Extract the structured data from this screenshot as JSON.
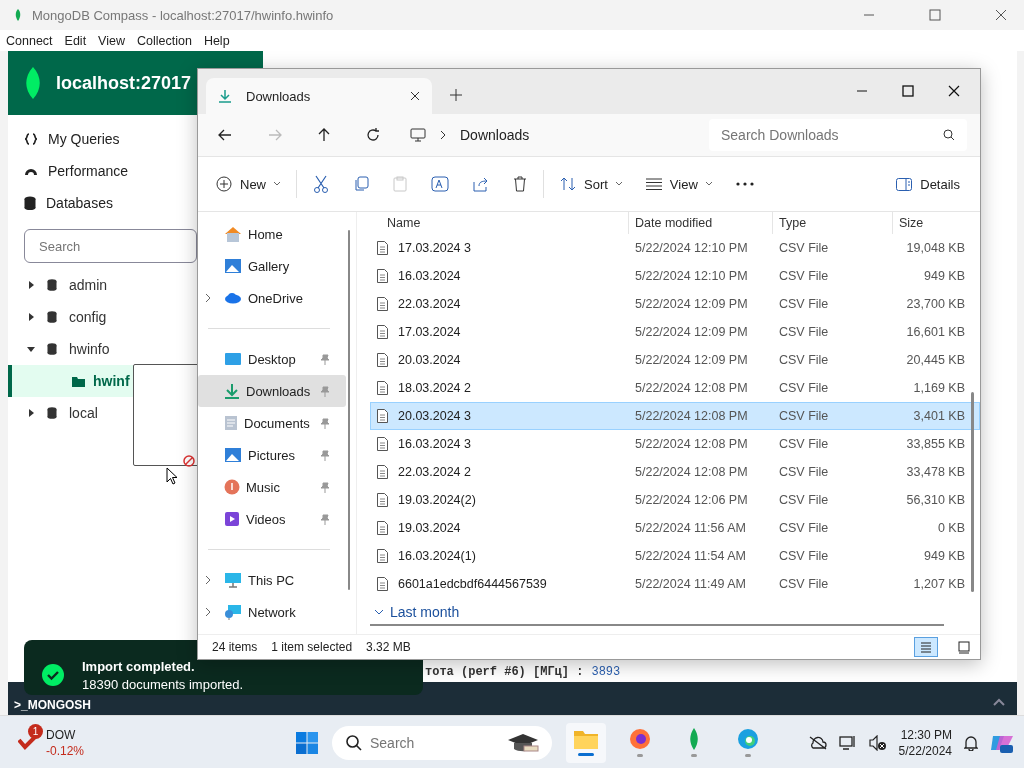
{
  "compass": {
    "title": "MongoDB Compass - localhost:27017/hwinfo.hwinfo",
    "menu": [
      "Connect",
      "Edit",
      "View",
      "Collection",
      "Help"
    ],
    "host": "localhost:27017",
    "nav": [
      {
        "label": "My Queries",
        "kind": "queries"
      },
      {
        "label": "Performance",
        "kind": "performance"
      },
      {
        "label": "Databases",
        "kind": "databases"
      }
    ],
    "search": {
      "placeholder": "Search"
    },
    "databases": [
      {
        "name": "admin",
        "expanded": false
      },
      {
        "name": "config",
        "expanded": false
      },
      {
        "name": "hwinfo",
        "expanded": true,
        "children": [
          {
            "name": "hwinf",
            "selected": true
          }
        ]
      },
      {
        "name": "local",
        "expanded": false
      }
    ],
    "shell_line": {
      "key": "тота (perf #6) [МГц] :",
      "value": "3893"
    },
    "shell_label": ">_MONGOSH",
    "toast": {
      "title": "Import completed.",
      "message": "18390 documents imported."
    }
  },
  "explorer": {
    "tab": "Downloads",
    "forward_disabled": true,
    "breadcrumb": "Downloads",
    "search": {
      "placeholder": "Search Downloads"
    },
    "toolbar": {
      "new": "New",
      "paste_disabled": true,
      "sort": "Sort",
      "view": "View",
      "details": "Details"
    },
    "nav": [
      {
        "label": "Home",
        "kind": "home",
        "expandable": false,
        "pinned": false,
        "selected": false
      },
      {
        "label": "Gallery",
        "kind": "gallery",
        "expandable": false,
        "pinned": false,
        "selected": false
      },
      {
        "label": "OneDrive",
        "kind": "cloud",
        "expandable": true,
        "pinned": false,
        "selected": false
      },
      {
        "kind": "divider"
      },
      {
        "label": "Desktop",
        "kind": "desktop",
        "expandable": false,
        "pinned": true,
        "selected": false
      },
      {
        "label": "Downloads",
        "kind": "downloads",
        "expandable": false,
        "pinned": true,
        "selected": true
      },
      {
        "label": "Documents",
        "kind": "documents",
        "expandable": false,
        "pinned": true,
        "selected": false
      },
      {
        "label": "Pictures",
        "kind": "pictures",
        "expandable": false,
        "pinned": true,
        "selected": false
      },
      {
        "label": "Music",
        "kind": "music",
        "expandable": false,
        "pinned": true,
        "selected": false
      },
      {
        "label": "Videos",
        "kind": "videos",
        "expandable": false,
        "pinned": true,
        "selected": false
      },
      {
        "kind": "divider"
      },
      {
        "label": "This PC",
        "kind": "pc",
        "expandable": true,
        "pinned": false,
        "selected": false
      },
      {
        "label": "Network",
        "kind": "network",
        "expandable": true,
        "pinned": false,
        "selected": false
      }
    ],
    "columns": [
      "Name",
      "Date modified",
      "Type",
      "Size"
    ],
    "files": [
      {
        "name": "17.03.2024 3",
        "date": "5/22/2024 12:10 PM",
        "type": "CSV File",
        "size": "19,048 KB",
        "selected": false
      },
      {
        "name": "16.03.2024",
        "date": "5/22/2024 12:10 PM",
        "type": "CSV File",
        "size": "949 KB",
        "selected": false
      },
      {
        "name": "22.03.2024",
        "date": "5/22/2024 12:09 PM",
        "type": "CSV File",
        "size": "23,700 KB",
        "selected": false
      },
      {
        "name": "17.03.2024",
        "date": "5/22/2024 12:09 PM",
        "type": "CSV File",
        "size": "16,601 KB",
        "selected": false
      },
      {
        "name": "20.03.2024",
        "date": "5/22/2024 12:09 PM",
        "type": "CSV File",
        "size": "20,445 KB",
        "selected": false
      },
      {
        "name": "18.03.2024 2",
        "date": "5/22/2024 12:08 PM",
        "type": "CSV File",
        "size": "1,169 KB",
        "selected": false
      },
      {
        "name": "20.03.2024 3",
        "date": "5/22/2024 12:08 PM",
        "type": "CSV File",
        "size": "3,401 KB",
        "selected": true
      },
      {
        "name": "16.03.2024 3",
        "date": "5/22/2024 12:08 PM",
        "type": "CSV File",
        "size": "33,855 KB",
        "selected": false
      },
      {
        "name": "22.03.2024 2",
        "date": "5/22/2024 12:08 PM",
        "type": "CSV File",
        "size": "33,478 KB",
        "selected": false
      },
      {
        "name": "19.03.2024(2)",
        "date": "5/22/2024 12:06 PM",
        "type": "CSV File",
        "size": "56,310 KB",
        "selected": false
      },
      {
        "name": "19.03.2024",
        "date": "5/22/2024 11:56 AM",
        "type": "CSV File",
        "size": "0 KB",
        "selected": false
      },
      {
        "name": "16.03.2024(1)",
        "date": "5/22/2024 11:54 AM",
        "type": "CSV File",
        "size": "949 KB",
        "selected": false
      },
      {
        "name": "6601a1edcbdf6444567539",
        "date": "5/22/2024 11:49 AM",
        "type": "CSV File",
        "size": "1,207 KB",
        "selected": false
      }
    ],
    "group": {
      "label": "Last month",
      "expanded": true
    },
    "status": {
      "count": "24 items",
      "selection": "1 item selected",
      "size": "3.32 MB"
    },
    "view_modes": [
      {
        "kind": "details",
        "selected": true
      },
      {
        "kind": "tiles",
        "selected": false
      }
    ]
  },
  "taskbar": {
    "widget": {
      "badge": "1",
      "name": "DOW",
      "change": "-0.12%"
    },
    "search": {
      "placeholder": "Search"
    },
    "apps": [
      {
        "kind": "explorer",
        "active": true
      },
      {
        "kind": "firefox",
        "active": false
      },
      {
        "kind": "mongodb",
        "active": false
      },
      {
        "kind": "edge",
        "active": false
      }
    ],
    "time": "12:30 PM",
    "date": "5/22/2024"
  }
}
